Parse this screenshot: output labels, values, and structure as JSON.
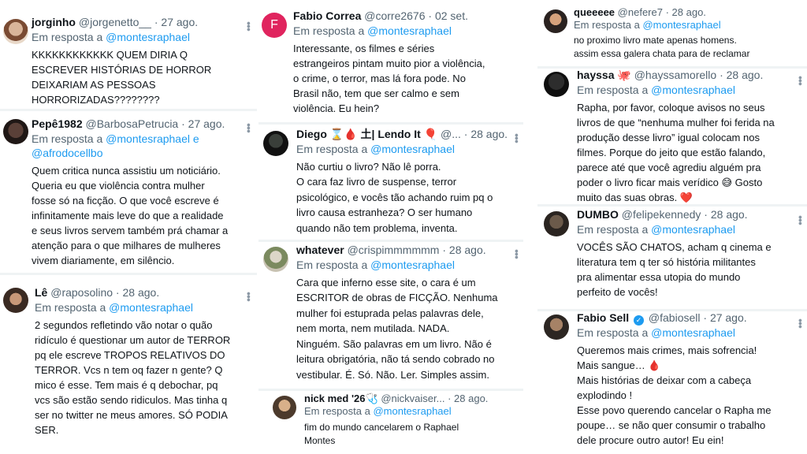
{
  "reply_prefix": "Em resposta a",
  "tweets": [
    {
      "name": "jorginho",
      "handle": "@jorgenetto__",
      "date": "27 ago.",
      "mentions": [
        "@montesraphael"
      ],
      "text": "KKKKKKKKKKKK QUEM DIRIA Q\nESCREVER HISTÓRIAS DE HORROR\nDEIXARIAM AS PESSOAS\nHORRORIZADAS????????"
    },
    {
      "name": "Pepê1982",
      "handle": "@BarbosaPetrucia",
      "date": "27 ago.",
      "mentions": [
        "@montesraphael",
        "@afrodocellbo"
      ],
      "mention_joiner": " e",
      "text": "Quem critica nunca assistiu um noticiário.\nQueria eu que violência contra mulher\nfosse só na ficção. O que você escreve é\ninfinitamente mais leve do que a realidade\ne seus livros servem também prá chamar a\natenção para o que milhares de mulheres\nvivem diariamente, em silêncio."
    },
    {
      "name": "Lê",
      "handle": "@raposolino",
      "date": "28 ago.",
      "mentions": [
        "@montesraphael"
      ],
      "text": "2 segundos refletindo vão notar o quão\nridículo é questionar um autor de TERROR\npq ele escreve TROPOS RELATIVOS DO\nTERROR. Vcs n tem oq fazer n gente? Q\nmico é esse. Tem mais é q debochar, pq\nvcs são estão sendo ridiculos. Mas tinha q\nser no twitter ne meus amores. SÓ PODIA\nSER."
    },
    {
      "name": "Fabio Correa",
      "handle": "@corre2676",
      "date": "02 set.",
      "avatar_letter": "F",
      "mentions": [
        "@montesraphael"
      ],
      "text": "Interessante, os filmes e séries\nestrangeiros pintam muito pior a violência,\no crime, o terror, mas lá fora pode. No\nBrasil não, tem que ser calmo e sem\nviolência. Eu hein?"
    },
    {
      "name": "Diego ⌛🩸 土| Lendo It 🎈",
      "handle": "@...",
      "date": "28 ago.",
      "mentions": [
        "@montesraphael"
      ],
      "text": "Não curtiu o livro? Não lê porra.\nO cara faz livro de suspense, terror\npsicológico, e vocês tão achando ruim pq o\nlivro causa estranheza? O ser humano\nquando não tem problema, inventa."
    },
    {
      "name": "whatever",
      "handle": "@crispimmmmmm",
      "date": "28 ago.",
      "mentions": [
        "@montesraphael"
      ],
      "text": "Cara que inferno esse site, o cara é um\nESCRITOR de obras de FICÇÃO. Nenhuma\nmulher foi estuprada pelas palavras dele,\nnem morta, nem mutilada. NADA.\nNinguém. São palavras em um livro. Não é\nleitura obrigatória, não tá sendo cobrado no\nvestibular. É. Só. Não. Ler. Simples assim."
    },
    {
      "name": "nick med '26🩺",
      "handle": "@nickvaiser...",
      "date": "28 ago.",
      "mentions": [
        "@montesraphael"
      ],
      "text": "fim do mundo cancelarem o Raphael\nMontes"
    },
    {
      "name": "queeeee",
      "handle": "@nefere7",
      "date": "28 ago.",
      "mentions": [
        "@montesraphael"
      ],
      "text": "no proximo livro mate apenas homens.\nassim essa galera chata para de reclamar"
    },
    {
      "name": "hayssa 🐙",
      "handle": "@hayssamorello",
      "date": "28 ago.",
      "mentions": [
        "@montesraphael"
      ],
      "text": "Rapha, por favor, coloque avisos no seus\nlivros de que “nenhuma mulher foi ferida na\nprodução desse livro” igual colocam nos\nfilmes. Porque do jeito que estão falando,\nparece até que você agrediu alguém pra\npoder o livro ficar mais verídico 😅 Gosto\nmuito das suas obras. ❤️"
    },
    {
      "name": "DUMBO",
      "handle": "@felipekennedy",
      "date": "28 ago.",
      "mentions": [
        "@montesraphael"
      ],
      "text": "VOCÊS SÃO CHATOS, acham q cinema e\nliteratura tem q ter só história militantes\npra alimentar essa utopia do mundo\nperfeito de vocês!"
    },
    {
      "name": "Fabio Sell",
      "handle": "@fabiosell",
      "date": "27 ago.",
      "verified": true,
      "mentions": [
        "@montesraphael"
      ],
      "text": "Queremos mais crimes, mais sofrencia!\nMais sangue… 🩸\nMais histórias de deixar com a cabeça\nexplodindo !\nEsse povo querendo cancelar o Rapha me\npoupe… se não quer consumir o trabalho\ndele procure outro autor! Eu ein!"
    }
  ]
}
